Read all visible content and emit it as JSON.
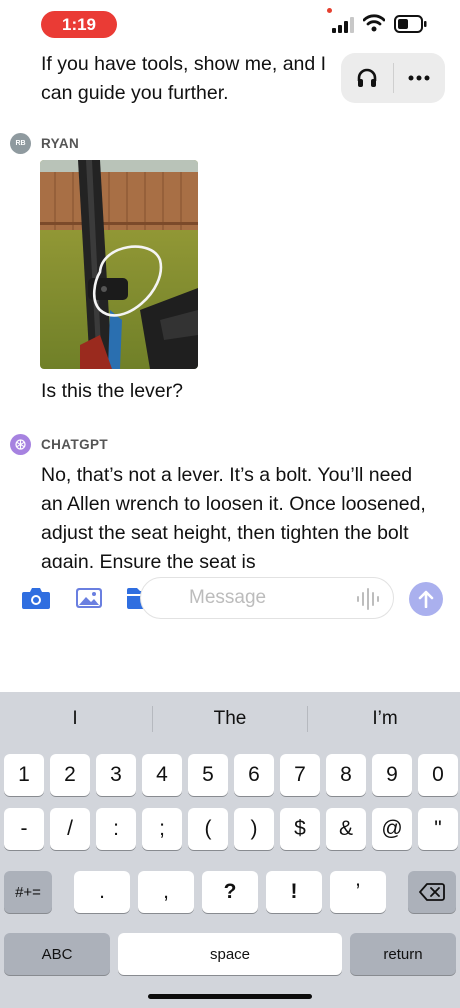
{
  "status_bar": {
    "time": "1:19"
  },
  "chat": {
    "previous_message": "If you have tools, show me, and I can guide you further.",
    "user": {
      "name": "RYAN",
      "initials": "RB",
      "message": "Is this the lever?"
    },
    "assistant": {
      "name": "CHATGPT",
      "message": "No, that’s not a lever. It’s a bolt. You’ll need an Allen wrench to loosen it. Once loosened, adjust the seat height, then tighten the bolt again. Ensure the seat is"
    }
  },
  "composer": {
    "placeholder": "Message",
    "value": ""
  },
  "keyboard": {
    "suggestions": [
      "I",
      "The",
      "I’m"
    ],
    "row1": [
      "1",
      "2",
      "3",
      "4",
      "5",
      "6",
      "7",
      "8",
      "9",
      "0"
    ],
    "row2": [
      "-",
      "/",
      ":",
      ";",
      "(",
      ")",
      "$",
      "&",
      "@",
      "\""
    ],
    "row3_mode": "#+=",
    "row3": [
      ".",
      ",",
      "?",
      "!",
      "’"
    ],
    "abc": "ABC",
    "space": "space",
    "return": "return"
  },
  "colors": {
    "recording": "#ea3b35",
    "accent": "#2f6ee0",
    "send": "#aab0ee",
    "assistant_avatar": "#a682e0"
  },
  "icons": [
    "signal-icon",
    "wifi-icon",
    "battery-icon",
    "headphones-icon",
    "more-icon",
    "camera-icon",
    "photo-icon",
    "folder-icon",
    "voice-icon",
    "arrow-up-icon",
    "backspace-icon",
    "openai-icon"
  ]
}
